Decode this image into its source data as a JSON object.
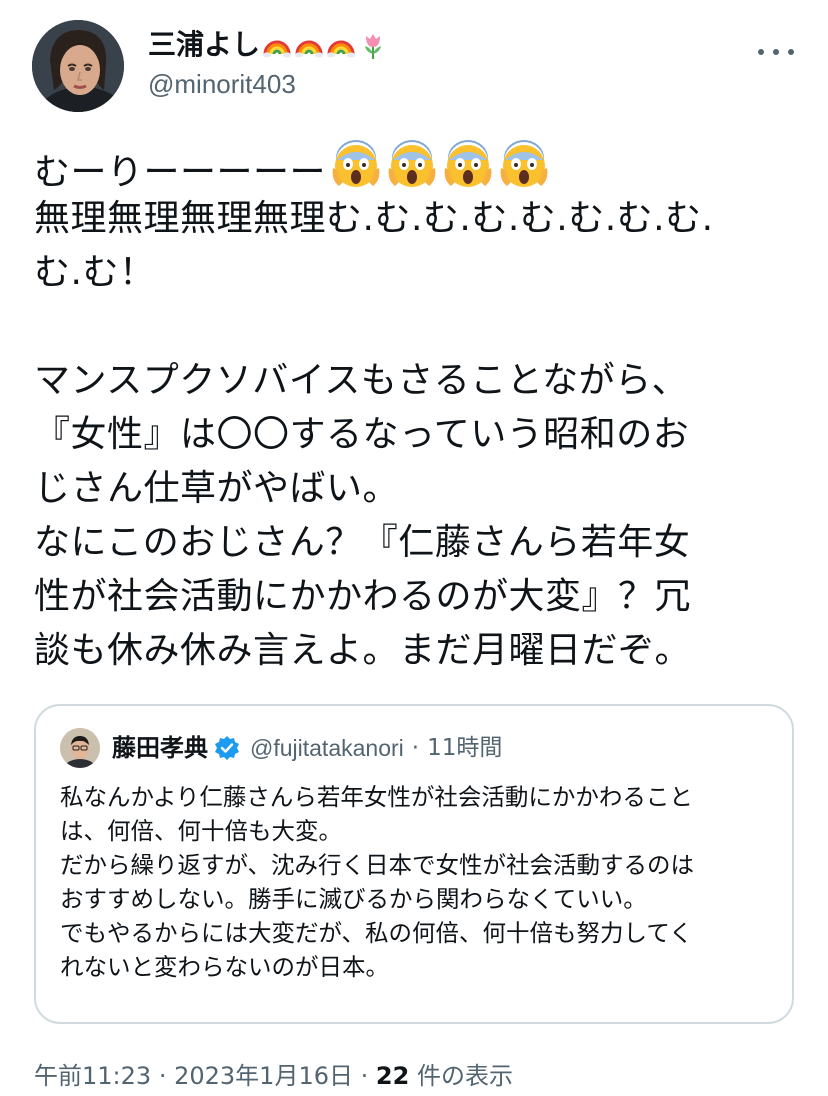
{
  "author": {
    "display_name": "三浦よし",
    "handle": "@minorit403",
    "name_emojis": [
      "rainbow-icon",
      "rainbow-icon",
      "rainbow-icon",
      "tulip-icon"
    ]
  },
  "tweet": {
    "lines": [
      "むーりーーーーー",
      "無理無理無理無理む.む.む.む.む.む.む.む.",
      "む.む！",
      "",
      "マンスプクソバイスもさることながら、",
      "『女性』は〇〇するなっていう昭和のお",
      "じさん仕草がやばい。",
      "なにこのおじさん？『仁藤さんら若年女",
      "性が社会活動にかかわるのが大変』？冗",
      "談も休み休み言えよ。まだ月曜日だぞ。"
    ],
    "first_line_emojis": [
      "screaming-face-icon",
      "screaming-face-icon",
      "screaming-face-icon",
      "screaming-face-icon"
    ]
  },
  "quote": {
    "display_name": "藤田孝典",
    "handle": "@fujitatakanori",
    "separator": "·",
    "time": "11時間",
    "lines": [
      "私なんかより仁藤さんら若年女性が社会活動にかかわること",
      "は、何倍、何十倍も大変。",
      "だから繰り返すが、沈み行く日本で女性が社会活動するのは",
      "おすすめしない。勝手に滅びるから関わらなくていい。",
      "でもやるからには大変だが、私の何倍、何十倍も努力してく",
      "れないと変わらないのが日本。"
    ]
  },
  "meta": {
    "time": "午前11:23",
    "separator": "·",
    "date": "2023年1月16日",
    "views_count": "22",
    "views_label": "件の表示"
  },
  "colors": {
    "text": "#0f1419",
    "secondary": "#536471",
    "border": "#cfd9de",
    "verified": "#1d9bf0"
  }
}
